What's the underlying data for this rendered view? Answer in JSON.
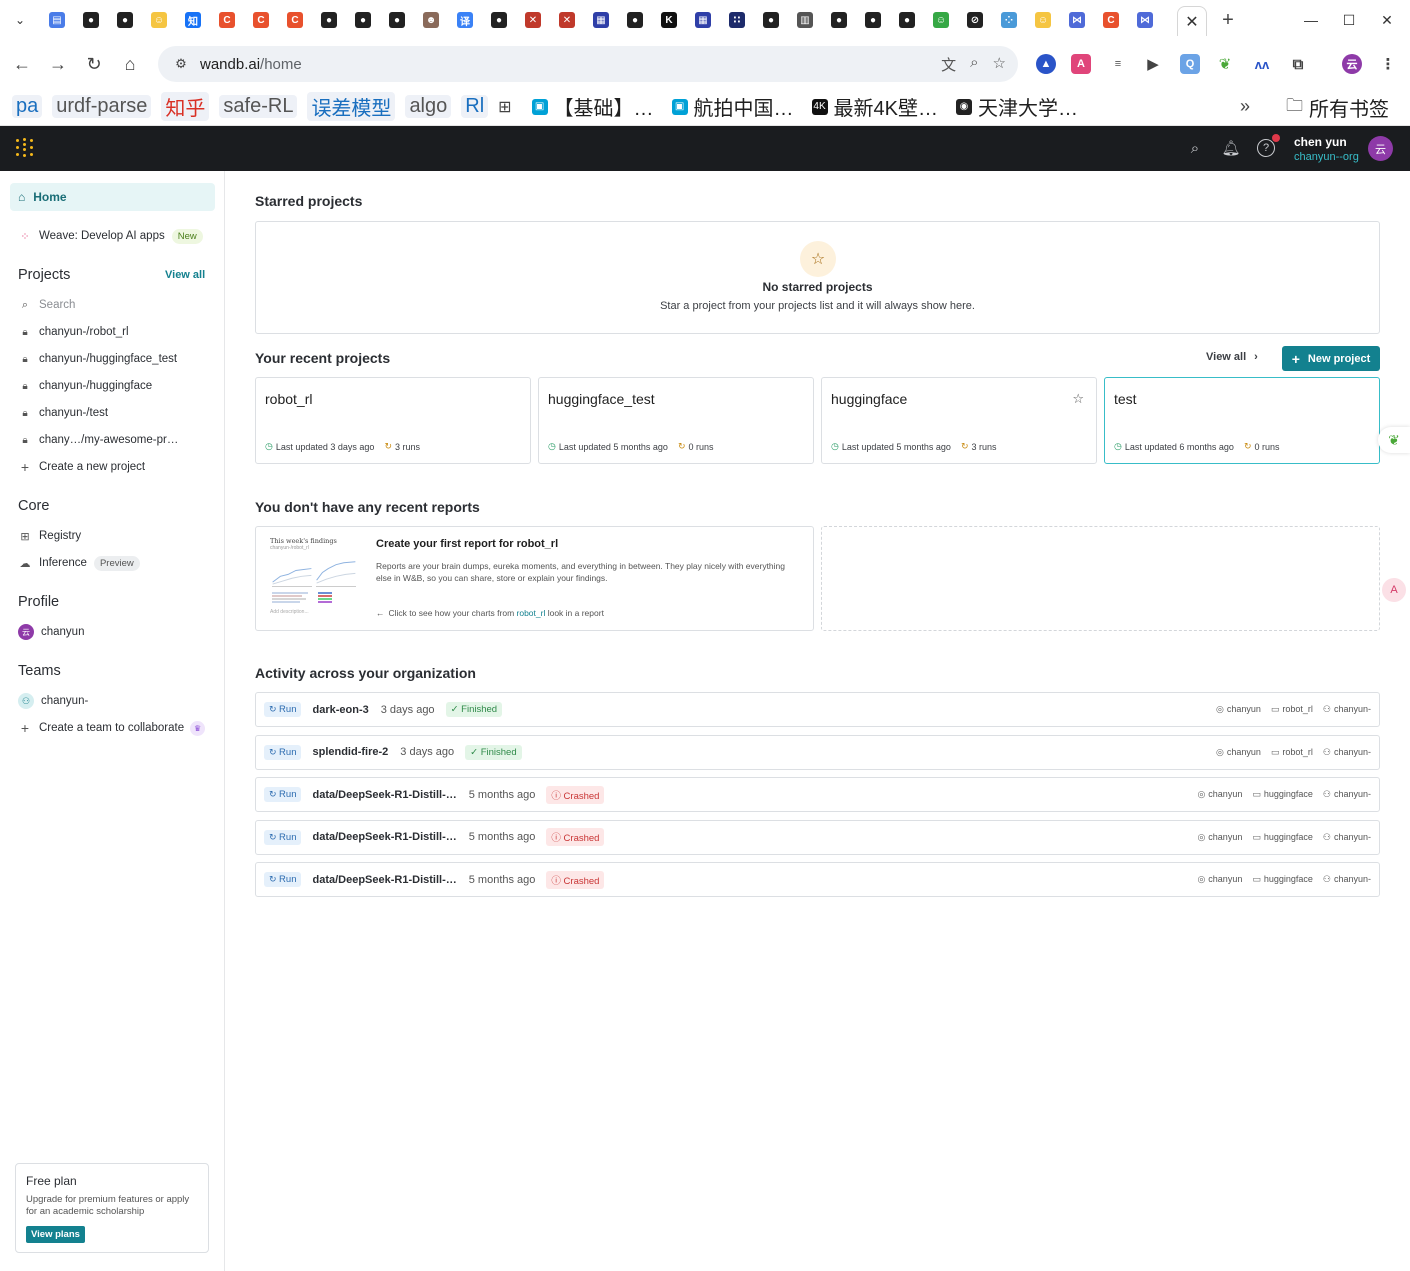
{
  "browser": {
    "url_host": "wandb.ai",
    "url_path": "/home",
    "tab_icons": [
      {
        "name": "docs-icon",
        "color": "#4a7ce8",
        "glyph": "▤"
      },
      {
        "name": "github-icon",
        "color": "#222222",
        "glyph": "●"
      },
      {
        "name": "github-icon",
        "color": "#222222",
        "glyph": "●"
      },
      {
        "name": "huggingface-icon",
        "color": "#f5c542",
        "glyph": "☺"
      },
      {
        "name": "zhihu-icon",
        "color": "#1772f6",
        "glyph": "知"
      },
      {
        "name": "csdn-icon",
        "color": "#e8512d",
        "glyph": "C"
      },
      {
        "name": "csdn-icon",
        "color": "#e8512d",
        "glyph": "C"
      },
      {
        "name": "csdn-icon",
        "color": "#e8512d",
        "glyph": "C"
      },
      {
        "name": "github-icon",
        "color": "#222222",
        "glyph": "●"
      },
      {
        "name": "github-icon",
        "color": "#222222",
        "glyph": "●"
      },
      {
        "name": "github-icon",
        "color": "#222222",
        "glyph": "●"
      },
      {
        "name": "avatar-icon",
        "color": "#8a6a5a",
        "glyph": "☻"
      },
      {
        "name": "translate-icon",
        "color": "#3b82f6",
        "glyph": "译"
      },
      {
        "name": "github-icon",
        "color": "#222222",
        "glyph": "●"
      },
      {
        "name": "x-icon",
        "color": "#c0392b",
        "glyph": "✕"
      },
      {
        "name": "x-icon",
        "color": "#c0392b",
        "glyph": "✕"
      },
      {
        "name": "window-icon",
        "color": "#2f3fa8",
        "glyph": "▦"
      },
      {
        "name": "github-icon",
        "color": "#222222",
        "glyph": "●"
      },
      {
        "name": "k-icon",
        "color": "#111111",
        "glyph": "K"
      },
      {
        "name": "window-icon",
        "color": "#2f3fa8",
        "glyph": "▦"
      },
      {
        "name": "dots-icon",
        "color": "#1d2b6b",
        "glyph": "∷"
      },
      {
        "name": "github-icon",
        "color": "#222222",
        "glyph": "●"
      },
      {
        "name": "book-icon",
        "color": "#555555",
        "glyph": "▥"
      },
      {
        "name": "github-icon",
        "color": "#222222",
        "glyph": "●"
      },
      {
        "name": "github-icon",
        "color": "#222222",
        "glyph": "●"
      },
      {
        "name": "github-icon",
        "color": "#222222",
        "glyph": "●"
      },
      {
        "name": "smile-icon",
        "color": "#36a845",
        "glyph": "☺"
      },
      {
        "name": "openai-icon",
        "color": "#222222",
        "glyph": "⊘"
      },
      {
        "name": "network-icon",
        "color": "#4a9ad8",
        "glyph": "⁘"
      },
      {
        "name": "huggingface-icon",
        "color": "#f5c542",
        "glyph": "☺"
      },
      {
        "name": "bowtie-icon",
        "color": "#4f6ad8",
        "glyph": "⋈"
      },
      {
        "name": "csdn-icon",
        "color": "#e8512d",
        "glyph": "C"
      },
      {
        "name": "bowtie-icon",
        "color": "#4f6ad8",
        "glyph": "⋈"
      }
    ],
    "bookmarks": [
      {
        "label": "pa",
        "color": "#1a6fbf",
        "chip": true
      },
      {
        "label": "urdf-parse",
        "color": "#555555",
        "chip": true
      },
      {
        "label": "知乎",
        "color": "#d93025",
        "chip": true
      },
      {
        "label": "safe-RL",
        "color": "#555555",
        "chip": true
      },
      {
        "label": "误差模型",
        "color": "#1a6fbf",
        "chip": true
      },
      {
        "label": "algo",
        "color": "#555555",
        "chip": true
      },
      {
        "label": "Rl",
        "color": "#1a6fbf",
        "chip": true
      },
      {
        "label": "【基础】…",
        "color": "#1f1f1f",
        "chip": false,
        "icon": "bilibili-icon",
        "icon_color": "#00a1d6"
      },
      {
        "label": "航拍中国…",
        "color": "#1f1f1f",
        "chip": false,
        "icon": "bilibili-icon",
        "icon_color": "#00a1d6"
      },
      {
        "label": "最新4K壁…",
        "color": "#1f1f1f",
        "chip": false,
        "icon": "4k-icon",
        "icon_color": "#111111"
      },
      {
        "label": "天津大学…",
        "color": "#1f1f1f",
        "chip": false,
        "icon": "globe-icon",
        "icon_color": "#222222"
      }
    ],
    "all_bookmarks": "所有书签"
  },
  "header": {
    "user_name": "chen yun",
    "user_org": "chanyun--org",
    "avatar_letter": "云"
  },
  "sidebar": {
    "home": "Home",
    "weave": "Weave: Develop AI apps",
    "weave_badge": "New",
    "projects_heading": "Projects",
    "view_all": "View all",
    "search_placeholder": "Search",
    "projects": [
      "chanyun-/robot_rl",
      "chanyun-/huggingface_test",
      "chanyun-/huggingface",
      "chanyun-/test",
      "chany…/my-awesome-pr…"
    ],
    "create_project": "Create a new project",
    "core_heading": "Core",
    "registry": "Registry",
    "inference": "Inference",
    "inference_badge": "Preview",
    "profile_heading": "Profile",
    "profile_name": "chanyun",
    "profile_avatar": "云",
    "teams_heading": "Teams",
    "team_name": "chanyun-",
    "create_team": "Create a team to collaborate",
    "free_plan_title": "Free plan",
    "free_plan_text": "Upgrade for premium features or apply for an academic scholarship",
    "view_plans": "View plans"
  },
  "main": {
    "starred_title": "Starred projects",
    "starred_empty_heading": "No starred projects",
    "starred_empty_text": "Star a project from your projects list and it will always show here.",
    "recent_title": "Your recent projects",
    "recent_view_all": "View all",
    "new_project": "New project",
    "recent_projects": [
      {
        "name": "robot_rl",
        "updated": "Last updated 3 days ago",
        "runs": "3 runs"
      },
      {
        "name": "huggingface_test",
        "updated": "Last updated 5 months ago",
        "runs": "0 runs"
      },
      {
        "name": "huggingface",
        "updated": "Last updated 5 months ago",
        "runs": "3 runs"
      },
      {
        "name": "test",
        "updated": "Last updated 6 months ago",
        "runs": "0 runs"
      }
    ],
    "reports_title": "You don't have any recent reports",
    "report_thumb_title": "This week's findings",
    "report_thumb_sub": "chanyun-/robot_rl",
    "report_thumb_foot": "Add description...",
    "report_heading": "Create your first report for robot_rl",
    "report_text": "Reports are your brain dumps, eureka moments, and everything in between. They play nicely with everything else in W&B, so you can share, store or explain your findings.",
    "report_link_prefix": "Click to see how your charts from ",
    "report_link_project": "robot_rl",
    "report_link_suffix": " look in a report",
    "activity_title": "Activity across your organization",
    "activity": [
      {
        "tag": "Run",
        "name": "dark-eon-3",
        "time": "3 days ago",
        "status": "Finished",
        "user": "chanyun",
        "project": "robot_rl",
        "team": "chanyun-"
      },
      {
        "tag": "Run",
        "name": "splendid-fire-2",
        "time": "3 days ago",
        "status": "Finished",
        "user": "chanyun",
        "project": "robot_rl",
        "team": "chanyun-"
      },
      {
        "tag": "Run",
        "name": "data/DeepSeek-R1-Distill-…",
        "time": "5 months ago",
        "status": "Crashed",
        "user": "chanyun",
        "project": "huggingface",
        "team": "chanyun-"
      },
      {
        "tag": "Run",
        "name": "data/DeepSeek-R1-Distill-…",
        "time": "5 months ago",
        "status": "Crashed",
        "user": "chanyun",
        "project": "huggingface",
        "team": "chanyun-"
      },
      {
        "tag": "Run",
        "name": "data/DeepSeek-R1-Distill-…",
        "time": "5 months ago",
        "status": "Crashed",
        "user": "chanyun",
        "project": "huggingface",
        "team": "chanyun-"
      }
    ]
  }
}
